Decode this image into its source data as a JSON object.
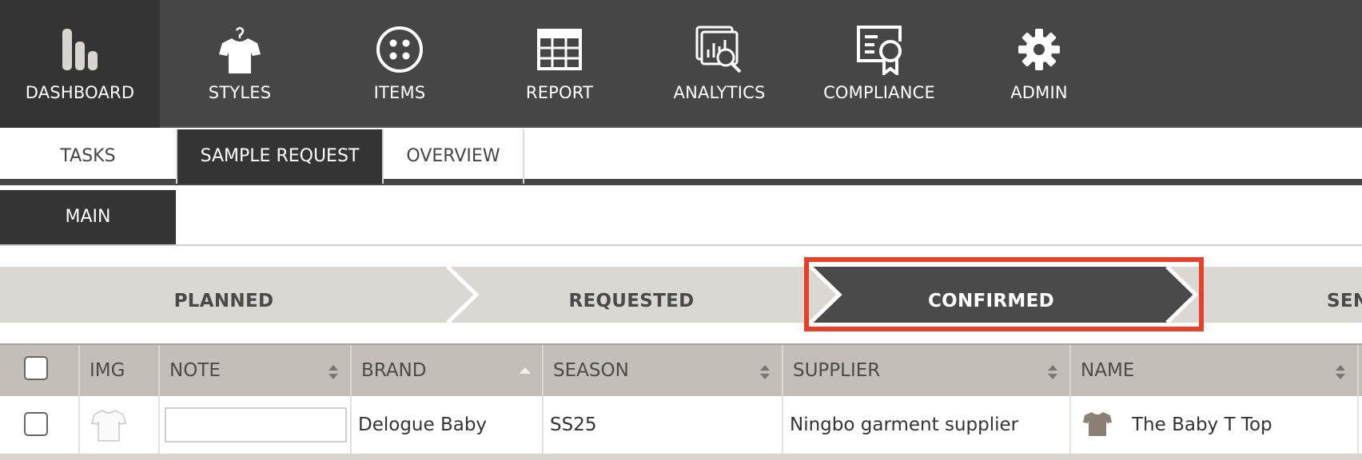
{
  "nav": {
    "items": [
      {
        "label": "DASHBOARD",
        "icon": "bars-chart-icon",
        "active": true
      },
      {
        "label": "STYLES",
        "icon": "tshirt-icon"
      },
      {
        "label": "ITEMS",
        "icon": "button-icon"
      },
      {
        "label": "REPORT",
        "icon": "table-grid-icon"
      },
      {
        "label": "ANALYTICS",
        "icon": "analytics-magnifier-icon"
      },
      {
        "label": "COMPLIANCE",
        "icon": "certificate-icon"
      },
      {
        "label": "ADMIN",
        "icon": "gear-icon"
      }
    ]
  },
  "tabs": [
    {
      "label": "TASKS"
    },
    {
      "label": "SAMPLE REQUEST",
      "active": true
    },
    {
      "label": "OVERVIEW"
    }
  ],
  "subtabs": [
    {
      "label": "MAIN",
      "active": true
    }
  ],
  "stepper": {
    "steps": [
      {
        "label": "PLANNED"
      },
      {
        "label": "REQUESTED"
      },
      {
        "label": "CONFIRMED",
        "active": true
      },
      {
        "label": "SEN"
      }
    ],
    "highlight_color": "#e5402a"
  },
  "table": {
    "columns": [
      "IMG",
      "NOTE",
      "BRAND",
      "SEASON",
      "SUPPLIER",
      "NAME"
    ],
    "rows": [
      {
        "note": "",
        "brand": "Delogue Baby",
        "season": "SS25",
        "supplier": "Ningbo garment supplier",
        "name": "The Baby T Top"
      }
    ]
  },
  "colors": {
    "nav_bg": "#464646",
    "nav_active": "#343434",
    "header_bg": "#c3beb8",
    "step_bg": "#dbd8d4",
    "step_active": "#4a4a4a"
  }
}
